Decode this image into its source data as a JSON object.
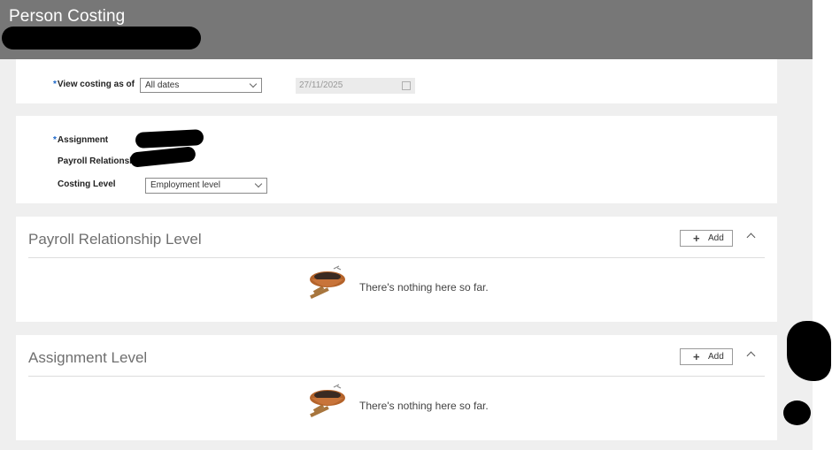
{
  "header": {
    "title": "Person Costing"
  },
  "filter": {
    "view_label": "View costing as of",
    "view_value": "All dates",
    "date_value": "27/11/2025"
  },
  "assignment_card": {
    "assignment_label": "Assignment",
    "payroll_relationship_label": "Payroll Relationship",
    "costing_level_label": "Costing Level",
    "costing_level_value": "Employment level"
  },
  "sections": [
    {
      "title": "Payroll Relationship Level",
      "add_label": "Add",
      "empty_text": "There's nothing here so far."
    },
    {
      "title": "Assignment Level",
      "add_label": "Add",
      "empty_text": "There's nothing here so far."
    }
  ],
  "icons": {
    "add": "plus-icon",
    "collapse": "chevron-up-icon",
    "empty": "empty-nest-icon",
    "calendar": "calendar-icon"
  },
  "colors": {
    "header_bg": "#777777",
    "required_marker": "#1a66c8",
    "page_bg": "#efefef"
  }
}
